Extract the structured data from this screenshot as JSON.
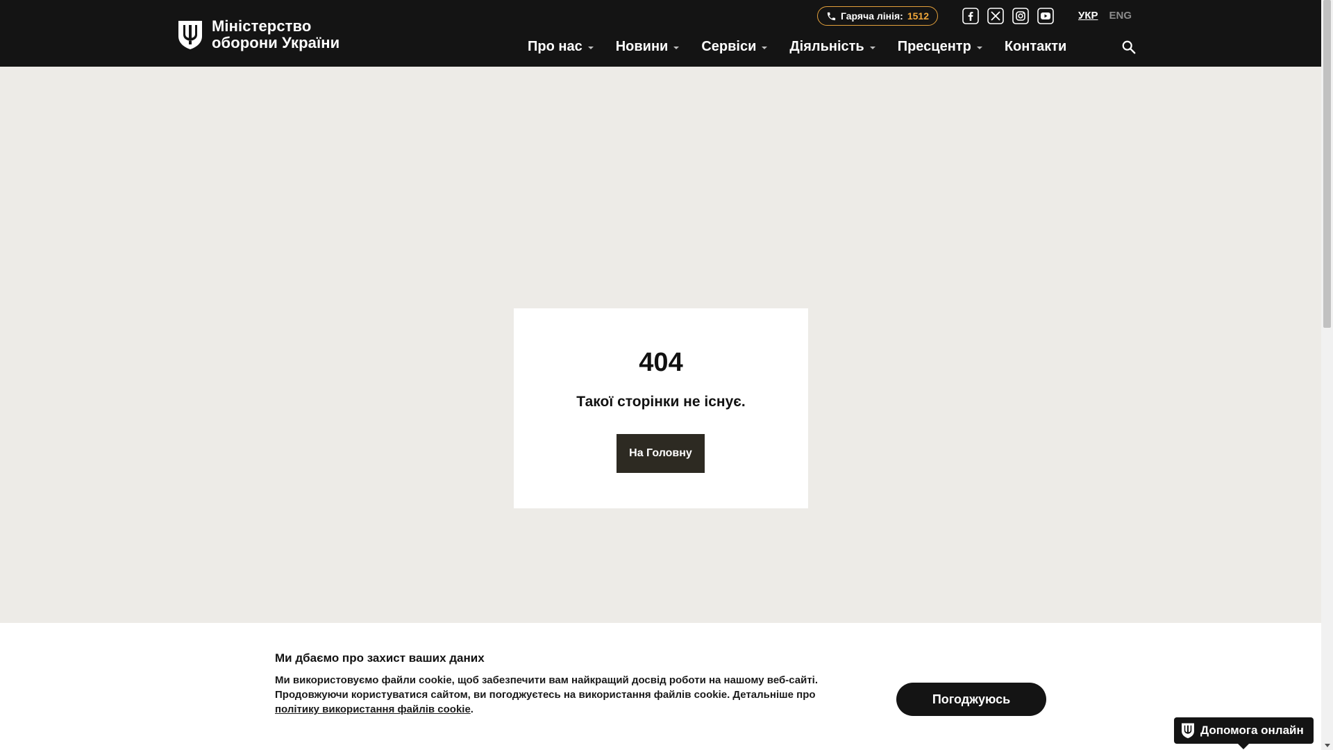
{
  "header": {
    "logo_line1": "Міністерство",
    "logo_line2": "оборони України",
    "hotline_label": "Гаряча лінія:",
    "hotline_number": "1512",
    "socials": [
      {
        "icon": "facebook-icon"
      },
      {
        "icon": "x-twitter-icon"
      },
      {
        "icon": "instagram-icon"
      },
      {
        "icon": "youtube-icon"
      }
    ],
    "lang_active": "УКР",
    "lang_other": "ENG",
    "nav": [
      {
        "label": "Про нас",
        "has_dropdown": true
      },
      {
        "label": "Новини",
        "has_dropdown": true
      },
      {
        "label": "Сервіси",
        "has_dropdown": true
      },
      {
        "label": "Діяльність",
        "has_dropdown": true
      },
      {
        "label": "Пресцентр",
        "has_dropdown": true
      },
      {
        "label": "Контакти",
        "has_dropdown": false
      }
    ],
    "search_icon": "search-icon"
  },
  "error": {
    "code": "404",
    "message": "Такої сторінки не існує.",
    "home_button": "На Головну"
  },
  "cookie": {
    "title": "Ми дбаємо про захист ваших даних",
    "text_line1": "Ми використовуємо файли cookie, щоб забезпечити вам найкращий досвід роботи на нашому веб-сайті.",
    "text_line2": "Продовжуючи користуватися сайтом, ви погоджуєтесь на використання файлів cookie. Детальніше про",
    "link": "політику використання файлів cookie",
    "link_suffix": ".",
    "agree_button": "Погоджуюсь"
  },
  "help": {
    "label": "Допомога онлайн"
  },
  "colors": {
    "header_bg": "#141414",
    "page_bg": "#edebe7",
    "accent_orange": "#f0a73a",
    "button_dark": "#2d2a22"
  }
}
